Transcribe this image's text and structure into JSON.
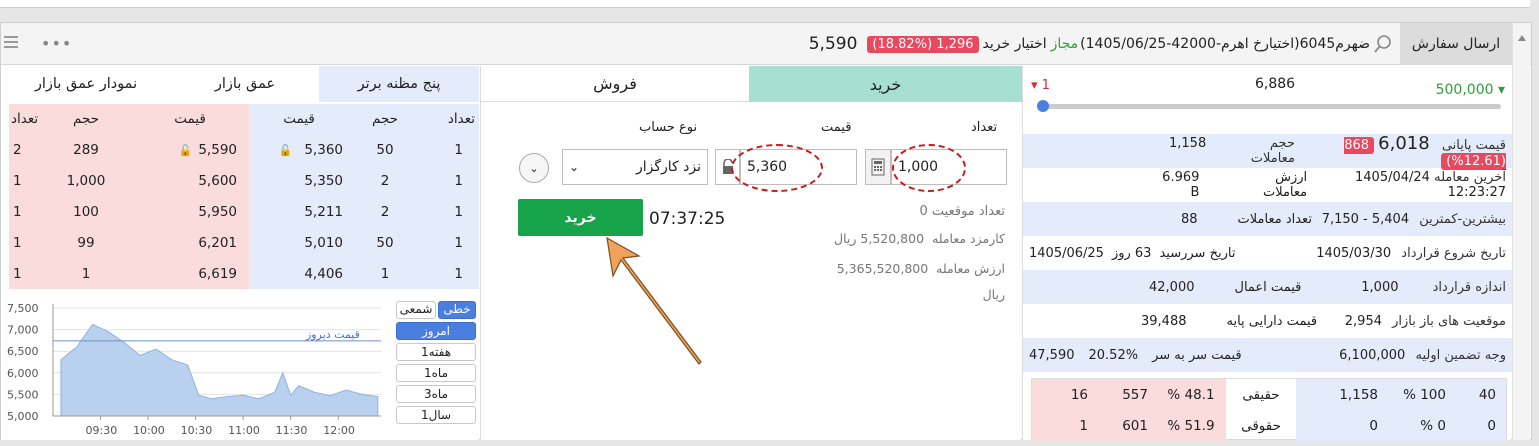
{
  "header": {
    "send_order": "ارسال سفارش",
    "symbol": "ضهرم6045(اختیارخ اهرم-42000-1405/06/25)",
    "allowed": "مجاز",
    "option_type": "اختیار خرید",
    "change_badge": "1,296 (18.82%)",
    "last_price": "5,590",
    "colors": {
      "accent": "#e8495f",
      "positive": "#2e9e3a",
      "buy": "#17a34a"
    }
  },
  "slider": {
    "left": "500,000",
    "center": "6,886",
    "right": "1"
  },
  "stats": {
    "closing_label": "قیمت پایانی",
    "closing_value": "6,018",
    "closing_badge": "868 (12.61%)",
    "volume_label": "حجم معاملات",
    "volume_value": "1,158",
    "last_trade_label": "آخرین معامله",
    "last_trade_value": "1405/04/24 12:23:27",
    "trade_value_label": "ارزش معاملات",
    "trade_value_value": "6.969 B",
    "range_label": "بیشترین-کمترین",
    "range_value": "5,404 - 7,150",
    "count_label": "تعداد معاملات",
    "count_value": "88",
    "start_label": "تاریخ شروع قرارداد",
    "start_value": "1405/03/30",
    "maturity_label": "تاریخ سررسید",
    "maturity_days": "63 روز",
    "maturity_value": "1405/06/25",
    "size_label": "اندازه قرارداد",
    "size_value": "1,000",
    "strike_label": "قیمت اعمال",
    "strike_value": "42,000",
    "open_label": "موقعیت های باز بازار",
    "open_value": "2,954",
    "underlying_label": "قیمت دارایی پایه",
    "underlying_value": "39,488",
    "margin_label": "وجه تضمین اولیه",
    "margin_value": "6,100,000",
    "breakeven_label": "قیمت سر به سر",
    "breakeven_pct": "20.52%",
    "breakeven_value": "47,590"
  },
  "legal": {
    "real_label": "حقیقی",
    "legal_label": "حقوقی",
    "real": {
      "buy_count": "40",
      "buy_pct": "100 %",
      "buy_vol": "1,158",
      "sell_pct": "48.1 %",
      "sell_vol": "557",
      "sell_count": "16"
    },
    "legal": {
      "buy_count": "0",
      "buy_pct": "0 %",
      "buy_vol": "0",
      "sell_pct": "51.9 %",
      "sell_vol": "601",
      "sell_count": "1"
    }
  },
  "order": {
    "tab_buy": "خرید",
    "tab_sell": "فروش",
    "qty_label": "تعداد",
    "qty_value": "1,000",
    "price_label": "قیمت",
    "price_value": "5,360",
    "account_label": "نوع حساب",
    "account_value": "نزد کارگزار",
    "submit": "خرید",
    "time": "07:37:25",
    "position_label": "تعداد موقعیت",
    "position_value": "0",
    "fee_label": "کارمزد معامله",
    "fee_value": "5,520,800",
    "fee_unit": "ریال",
    "value_label": "ارزش معامله",
    "value_value": "5,365,520,800",
    "value_unit": "ریال"
  },
  "book": {
    "tabs": [
      "پنج مظنه برتر",
      "عمق بازار",
      "نمودار عمق بازار"
    ],
    "headers": {
      "count": "تعداد",
      "volume": "حجم",
      "price": "قیمت"
    },
    "rows": [
      {
        "bid_count": "1",
        "bid_vol": "50",
        "bid_price": "5,360",
        "ask_price": "5,590",
        "ask_vol": "289",
        "ask_count": "2"
      },
      {
        "bid_count": "1",
        "bid_vol": "2",
        "bid_price": "5,350",
        "ask_price": "5,600",
        "ask_vol": "1,000",
        "ask_count": "1"
      },
      {
        "bid_count": "1",
        "bid_vol": "2",
        "bid_price": "5,211",
        "ask_price": "5,950",
        "ask_vol": "100",
        "ask_count": "1"
      },
      {
        "bid_count": "1",
        "bid_vol": "50",
        "bid_price": "5,010",
        "ask_price": "6,201",
        "ask_vol": "99",
        "ask_count": "1"
      },
      {
        "bid_count": "1",
        "bid_vol": "1",
        "bid_price": "4,406",
        "ask_price": "6,619",
        "ask_vol": "1",
        "ask_count": "1"
      }
    ]
  },
  "chart_controls": {
    "line": "خطی",
    "candle": "شمعی",
    "ranges": [
      "امروز",
      "1هفته",
      "1ماه",
      "3ماه",
      "1سال"
    ]
  },
  "chart_data": {
    "type": "area",
    "annotation": "قیمت دیروز",
    "reference_line": 6740,
    "yticks": [
      "7,500",
      "7,000",
      "6,500",
      "6,000",
      "5,500",
      "5,000"
    ],
    "xticks": [
      "09:30",
      "10:00",
      "10:30",
      "11:00",
      "11:30",
      "12:00"
    ],
    "ylim": [
      5000,
      7500
    ],
    "x": [
      "09:05",
      "09:15",
      "09:25",
      "09:35",
      "09:45",
      "09:55",
      "10:05",
      "10:15",
      "10:25",
      "10:32",
      "10:40",
      "10:50",
      "11:00",
      "11:10",
      "11:20",
      "11:25",
      "11:30",
      "11:35",
      "11:45",
      "11:55",
      "12:05",
      "12:15",
      "12:25"
    ],
    "values": [
      6300,
      6600,
      7120,
      6950,
      6700,
      6400,
      6550,
      6300,
      6180,
      5480,
      5400,
      5450,
      5480,
      5400,
      5550,
      6000,
      5480,
      5700,
      5550,
      5470,
      5600,
      5500,
      5450
    ]
  }
}
